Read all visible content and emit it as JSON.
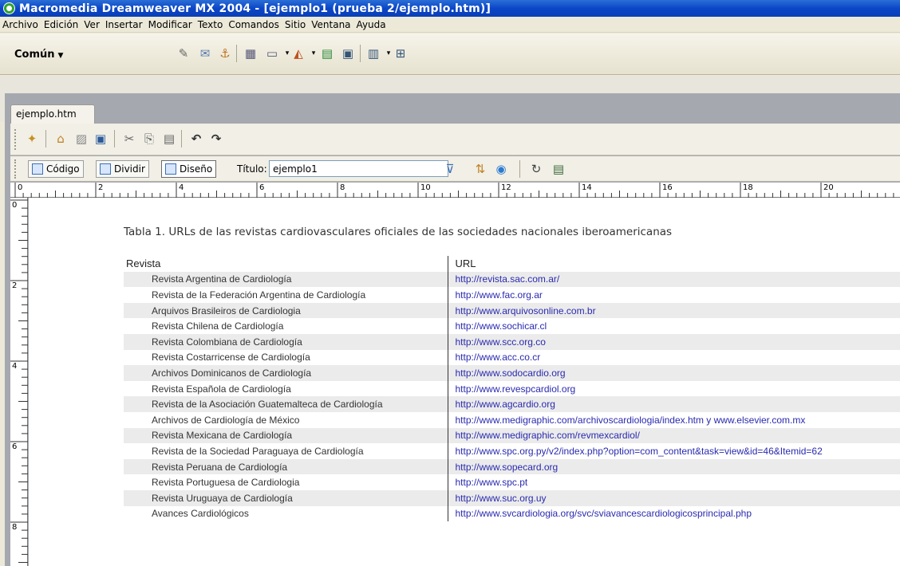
{
  "window": {
    "title": "Macromedia Dreamweaver MX 2004 - [ejemplo1 (prueba 2/ejemplo.htm)]"
  },
  "menu": [
    "Archivo",
    "Edición",
    "Ver",
    "Insertar",
    "Modificar",
    "Texto",
    "Comandos",
    "Sitio",
    "Ventana",
    "Ayuda"
  ],
  "insertbar": {
    "category": "Común"
  },
  "document": {
    "tab": "ejemplo.htm"
  },
  "doc_toolbar": {
    "code_label": "Código",
    "split_label": "Dividir",
    "design_label": "Diseño",
    "title_label": "Título:",
    "title_value": "ejemplo1"
  },
  "ruler": {
    "h_labels": [
      "0",
      "2",
      "4",
      "6",
      "8",
      "10",
      "12",
      "14",
      "16",
      "18",
      "20"
    ],
    "v_labels": [
      "0",
      "2",
      "4",
      "6",
      "8"
    ]
  },
  "page": {
    "caption": "Tabla 1. URLs de las revistas cardiovasculares oficiales de las sociedades nacionales iberoamericanas",
    "headers": [
      "Revista",
      "URL"
    ],
    "rows": [
      [
        "Revista Argentina de Cardiología",
        "http://revista.sac.com.ar/"
      ],
      [
        "Revista de la Federación Argentina de Cardiología",
        "http://www.fac.org.ar"
      ],
      [
        "Arquivos Brasileiros de Cardiologia",
        "http://www.arquivosonline.com.br"
      ],
      [
        "Revista Chilena de Cardiología",
        "http://www.sochicar.cl"
      ],
      [
        "Revista Colombiana de Cardiología",
        "http://www.scc.org.co"
      ],
      [
        "Revista Costarricense de Cardiología",
        "http://www.acc.co.cr"
      ],
      [
        "Archivos Dominicanos de Cardiología",
        "http://www.sodocardio.org"
      ],
      [
        "Revista Española de Cardiología",
        "http://www.revespcardiol.org"
      ],
      [
        "Revista de la Asociación Guatemalteca de Cardiología",
        "http://www.agcardio.org"
      ],
      [
        "Archivos de Cardiología de México",
        "http://www.medigraphic.com/archivoscardiologia/index.htm y www.elsevier.com.mx"
      ],
      [
        "Revista Mexicana de Cardiología",
        "http://www.medigraphic.com/revmexcardiol/"
      ],
      [
        "Revista de la Sociedad Paraguaya de Cardiología",
        "http://www.spc.org.py/v2/index.php?option=com_content&task=view&id=46&Itemid=62"
      ],
      [
        "Revista Peruana de Cardiología",
        "http://www.sopecard.org"
      ],
      [
        "Revista Portuguesa de Cardiologia",
        "http://www.spc.pt"
      ],
      [
        "Revista Uruguaya de Cardiología",
        "http://www.suc.org.uy"
      ],
      [
        "Avances Cardiológicos",
        "http://www.svcardiologia.org/svc/sviavancescardiologicosprincipal.php"
      ]
    ]
  }
}
